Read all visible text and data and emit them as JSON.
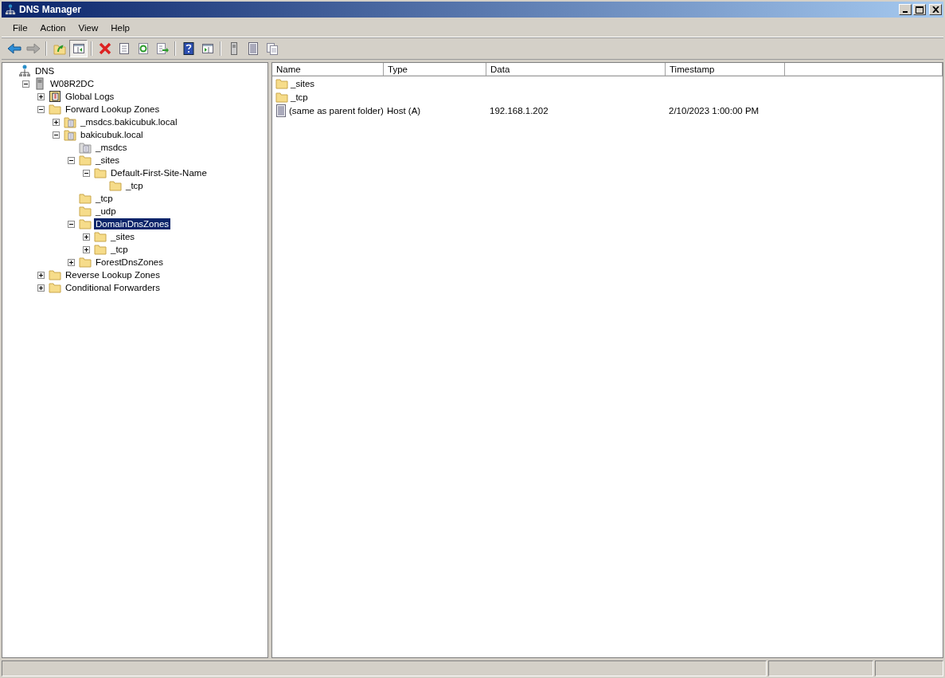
{
  "window": {
    "title": "DNS Manager"
  },
  "menu": [
    "File",
    "Action",
    "View",
    "Help"
  ],
  "toolbar": [
    {
      "kind": "back",
      "disabled": false,
      "pressed": false
    },
    {
      "kind": "forward",
      "disabled": true,
      "pressed": false
    },
    {
      "kind": "up",
      "disabled": false,
      "pressed": false
    },
    {
      "kind": "tree",
      "disabled": false,
      "pressed": true
    },
    {
      "kind": "delete",
      "disabled": false,
      "pressed": false
    },
    {
      "kind": "properties",
      "disabled": false,
      "pressed": false
    },
    {
      "kind": "refresh",
      "disabled": false,
      "pressed": false
    },
    {
      "kind": "export",
      "disabled": false,
      "pressed": false
    },
    {
      "kind": "help",
      "disabled": false,
      "pressed": false
    },
    {
      "kind": "pane",
      "disabled": false,
      "pressed": false
    },
    {
      "kind": "server",
      "disabled": false,
      "pressed": false
    },
    {
      "kind": "list",
      "disabled": false,
      "pressed": false
    },
    {
      "kind": "copy",
      "disabled": false,
      "pressed": false
    }
  ],
  "tree": [
    {
      "label": "DNS",
      "kind": "dns",
      "selected": false,
      "children": [
        {
          "label": "W08R2DC",
          "kind": "server",
          "expanded": true,
          "selected": false,
          "children": [
            {
              "label": "Global Logs",
              "kind": "logs",
              "expanded": false,
              "selected": false
            },
            {
              "label": "Forward Lookup Zones",
              "kind": "folder",
              "expanded": true,
              "selected": false,
              "children": [
                {
                  "label": "_msdcs.bakicubuk.local",
                  "kind": "zone",
                  "expanded": false,
                  "selected": false
                },
                {
                  "label": "bakicubuk.local",
                  "kind": "zone",
                  "expanded": true,
                  "selected": false,
                  "children": [
                    {
                      "label": "_msdcs",
                      "kind": "delegation",
                      "selected": false
                    },
                    {
                      "label": "_sites",
                      "kind": "folder",
                      "expanded": true,
                      "selected": false,
                      "children": [
                        {
                          "label": "Default-First-Site-Name",
                          "kind": "folder",
                          "expanded": true,
                          "selected": false,
                          "children": [
                            {
                              "label": "_tcp",
                              "kind": "folder",
                              "selected": false
                            }
                          ]
                        }
                      ]
                    },
                    {
                      "label": "_tcp",
                      "kind": "folder",
                      "selected": false
                    },
                    {
                      "label": "_udp",
                      "kind": "folder",
                      "selected": false
                    },
                    {
                      "label": "DomainDnsZones",
                      "kind": "folder",
                      "expanded": true,
                      "selected": true,
                      "children": [
                        {
                          "label": "_sites",
                          "kind": "folder",
                          "expanded": false,
                          "selected": false
                        },
                        {
                          "label": "_tcp",
                          "kind": "folder",
                          "expanded": false,
                          "selected": false
                        }
                      ]
                    },
                    {
                      "label": "ForestDnsZones",
                      "kind": "folder",
                      "expanded": false,
                      "selected": false
                    }
                  ]
                }
              ]
            },
            {
              "label": "Reverse Lookup Zones",
              "kind": "folder",
              "expanded": false,
              "selected": false
            },
            {
              "label": "Conditional Forwarders",
              "kind": "folder",
              "expanded": false,
              "selected": false
            }
          ]
        }
      ]
    }
  ],
  "list": {
    "columns": [
      "Name",
      "Type",
      "Data",
      "Timestamp"
    ],
    "rows": [
      {
        "kind": "folder",
        "name": "_sites"
      },
      {
        "kind": "folder",
        "name": "_tcp"
      },
      {
        "kind": "record",
        "name": "(same as parent folder)",
        "type": "Host (A)",
        "data": "192.168.1.202",
        "timestamp": "2/10/2023 1:00:00 PM"
      }
    ]
  }
}
